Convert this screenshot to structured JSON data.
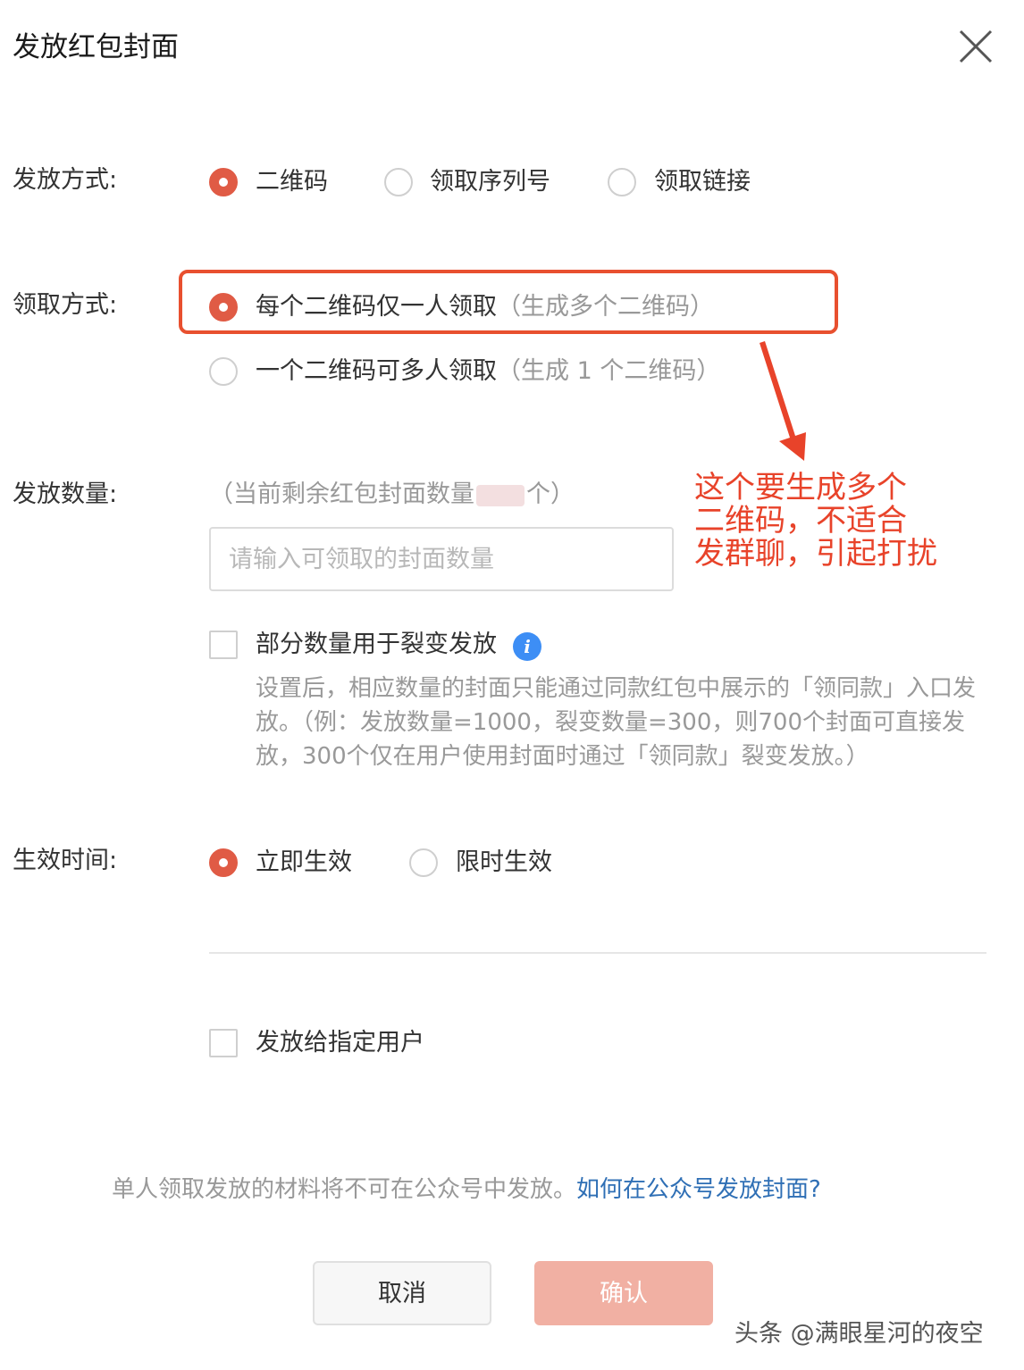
{
  "dialog": {
    "title": "发放红包封面"
  },
  "distribution_method": {
    "label": "发放方式:",
    "options": [
      {
        "label": "二维码",
        "selected": true
      },
      {
        "label": "领取序列号",
        "selected": false
      },
      {
        "label": "领取链接",
        "selected": false
      }
    ]
  },
  "receive_method": {
    "label": "领取方式:",
    "options": [
      {
        "label": "每个二维码仅一人领取",
        "hint": "（生成多个二维码）",
        "selected": true
      },
      {
        "label": "一个二维码可多人领取",
        "hint": "（生成 1 个二维码）",
        "selected": false
      }
    ]
  },
  "annotation": {
    "lines": [
      "这个要生成多个",
      "二维码，不适合",
      "发群聊，引起打扰"
    ],
    "color": "#e8432a"
  },
  "quantity": {
    "label": "发放数量:",
    "remaining_prefix": "（当前剩余红包封面数量",
    "remaining_suffix": "个）",
    "input_placeholder": "请输入可领取的封面数量",
    "input_value": ""
  },
  "split": {
    "checkbox_label": "部分数量用于裂变发放",
    "checked": false,
    "info_icon": "info-icon",
    "description": "设置后，相应数量的封面只能通过同款红包中展示的「领同款」入口发放。（例：发放数量=1000，裂变数量=300，则700个封面可直接发放，300个仅在用户使用封面时通过「领同款」裂变发放。）"
  },
  "effective_time": {
    "label": "生效时间:",
    "options": [
      {
        "label": "立即生效",
        "selected": true
      },
      {
        "label": "限时生效",
        "selected": false
      }
    ]
  },
  "specified_users": {
    "checkbox_label": "发放给指定用户",
    "checked": false
  },
  "notice": {
    "text": "单人领取发放的材料将不可在公众号中发放。",
    "link": "如何在公众号发放封面?"
  },
  "buttons": {
    "cancel": "取消",
    "confirm": "确认"
  },
  "watermark": "头条 @满眼星河的夜空",
  "colors": {
    "accent": "#e05b45",
    "highlight": "#e8502f",
    "confirm_disabled": "#f1b0a3",
    "link": "#2f6fb5",
    "info": "#3d8ef5"
  }
}
